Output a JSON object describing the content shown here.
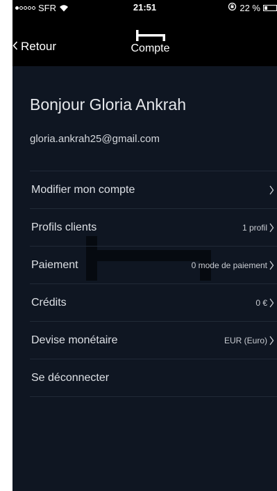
{
  "status_bar": {
    "carrier": "SFR",
    "time": "21:51",
    "battery_percent": "22 %",
    "battery_level": 0.22,
    "signal_bars_on": 1,
    "signal_bars_total": 5
  },
  "nav": {
    "back_label": "Retour",
    "title": "Compte"
  },
  "account": {
    "greeting": "Bonjour Gloria Ankrah",
    "email": "gloria.ankrah25@gmail.com"
  },
  "menu": {
    "items": [
      {
        "label": "Modifier mon compte",
        "value": "",
        "chevron": true
      },
      {
        "label": "Profils clients",
        "value": "1 profil",
        "chevron": true
      },
      {
        "label": "Paiement",
        "value": "0 mode de paiement",
        "chevron": true
      },
      {
        "label": "Crédits",
        "value": "0 €",
        "chevron": true
      },
      {
        "label": "Devise monétaire",
        "value": "EUR (Euro)",
        "chevron": true
      },
      {
        "label": "Se déconnecter",
        "value": "",
        "chevron": false
      }
    ]
  },
  "colors": {
    "background": "#0f1622",
    "bar": "#000000",
    "text": "#e6e8ec",
    "divider": "#212a37"
  }
}
